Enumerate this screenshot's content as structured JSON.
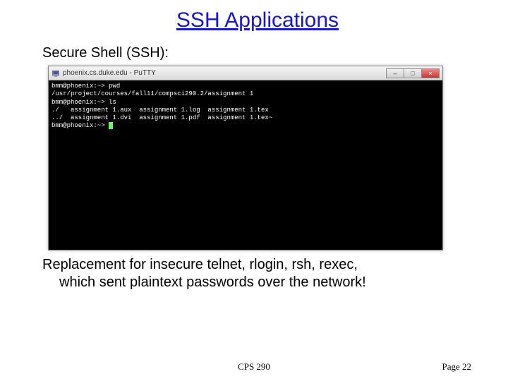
{
  "title": "SSH Applications",
  "subtitle": "Secure Shell (SSH):",
  "terminal": {
    "window_title": "phoenix.cs.duke.edu - PuTTY",
    "lines": [
      "bmm@phoenix:~> pwd",
      "/usr/project/courses/fall11/compsci290.2/assignment 1",
      "bmm@phoenix:~> ls",
      "./   assignment 1.aux  assignment 1.log  assignment 1.tex",
      "../  assignment 1.dvi  assignment 1.pdf  assignment 1.tex~",
      "bmm@phoenix:~> "
    ]
  },
  "caption_line1": "Replacement for insecure telnet, rlogin, rsh, rexec,",
  "caption_line2": "which sent plaintext passwords over the network!",
  "footer": {
    "course": "CPS 290",
    "page": "Page 22"
  },
  "icons": {
    "putty": "putty-icon",
    "minimize": "–",
    "maximize": "□",
    "close": "×"
  }
}
